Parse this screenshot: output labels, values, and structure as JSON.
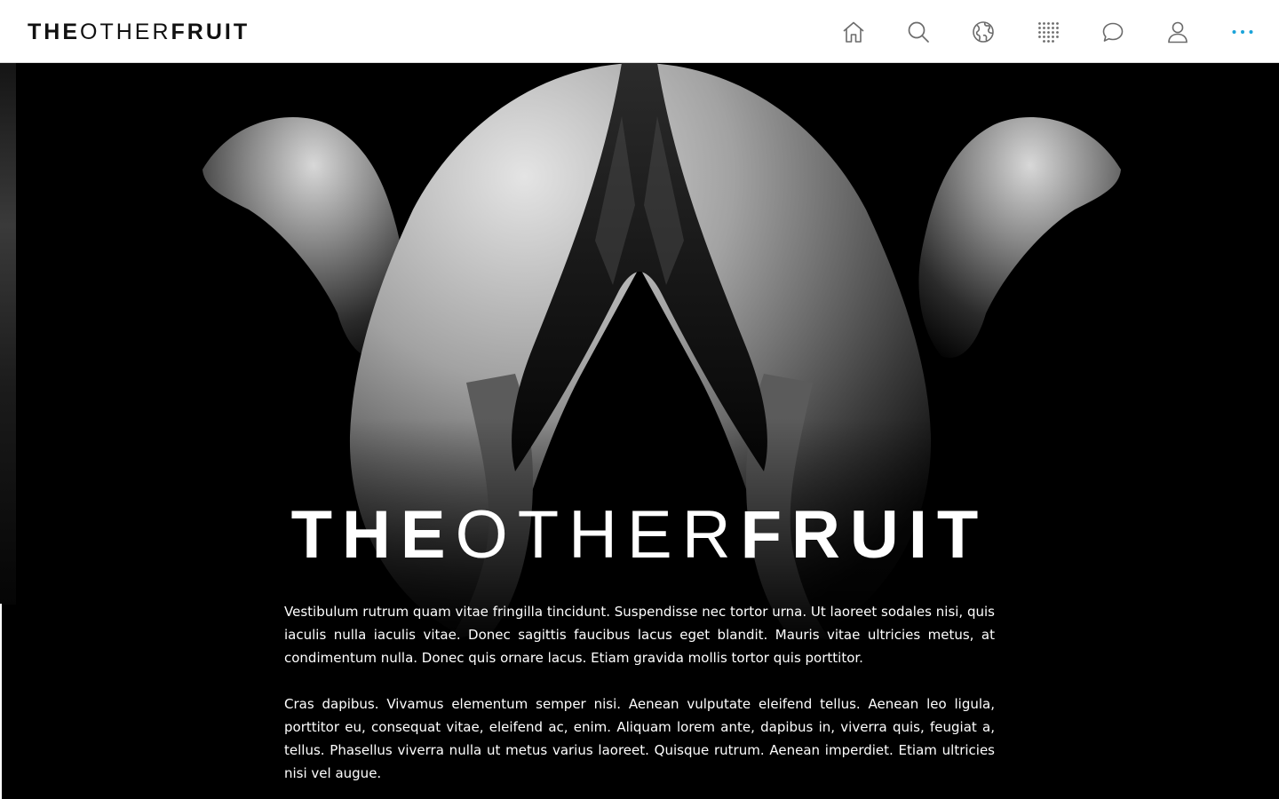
{
  "header": {
    "logo": {
      "part1": "THE",
      "part2": "OTHER",
      "part3": "FRUIT"
    },
    "nav": [
      {
        "name": "home",
        "icon": "home-icon"
      },
      {
        "name": "search",
        "icon": "search-icon"
      },
      {
        "name": "explore",
        "icon": "globe-icon"
      },
      {
        "name": "grid",
        "icon": "dot-grid-icon"
      },
      {
        "name": "messages",
        "icon": "chat-bubble-icon"
      },
      {
        "name": "profile",
        "icon": "user-icon"
      },
      {
        "name": "more",
        "icon": "more-dots-icon"
      }
    ],
    "accent_color": "#1aa3d9"
  },
  "hero": {
    "title": {
      "part1": "THE",
      "part2": "OTHER",
      "part3": "FRUIT"
    },
    "paragraphs": [
      "Vestibulum rutrum quam vitae fringilla tincidunt. Suspendisse nec tortor urna. Ut laoreet sodales nisi, quis iaculis nulla iaculis vitae. Donec sagittis faucibus lacus eget blandit. Mauris vitae ultricies metus, at condimentum nulla. Donec quis ornare lacus. Etiam gravida mollis tortor quis porttitor.",
      "Cras dapibus. Vivamus elementum semper nisi. Aenean vulputate eleifend tellus. Aenean leo ligula, porttitor eu, consequat vitae, eleifend ac, enim. Aliquam lorem ante, dapibus in, viverra quis, feugiat a, tellus. Phasellus viverra nulla ut metus varius laoreet. Quisque rutrum. Aenean imperdiet. Etiam ultricies nisi vel augue."
    ]
  }
}
